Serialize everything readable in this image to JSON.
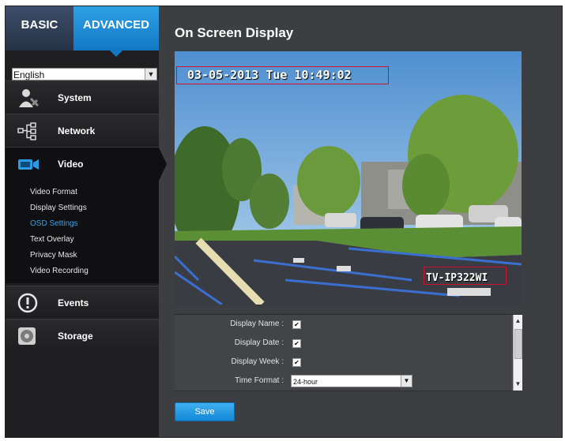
{
  "tabs": {
    "basic": "BASIC",
    "advanced": "ADVANCED"
  },
  "language": {
    "selected": "English"
  },
  "menu": {
    "system": "System",
    "network": "Network",
    "video": "Video",
    "events": "Events",
    "storage": "Storage"
  },
  "submenu": [
    {
      "label": "Video Format"
    },
    {
      "label": "Display Settings"
    },
    {
      "label": "OSD Settings",
      "active": true
    },
    {
      "label": "Text Overlay"
    },
    {
      "label": "Privacy Mask"
    },
    {
      "label": "Video Recording"
    }
  ],
  "page": {
    "title": "On Screen Display"
  },
  "video": {
    "osd_datetime": "03-05-2013 Tue 10:49:02",
    "camera_name": "TV-IP322WI"
  },
  "settings": {
    "display_name": {
      "label": "Display Name :",
      "checked": true
    },
    "display_date": {
      "label": "Display Date :",
      "checked": true
    },
    "display_week": {
      "label": "Display Week :",
      "checked": true
    },
    "time_format": {
      "label": "Time Format :",
      "value": "24-hour"
    }
  },
  "actions": {
    "save": "Save"
  },
  "colors": {
    "accent": "#1b8fdc",
    "active_submenu": "#3aa0e8",
    "osd_box": "#d0112b",
    "panel": "#3d3e42",
    "sidebar": "#1f1f21"
  }
}
